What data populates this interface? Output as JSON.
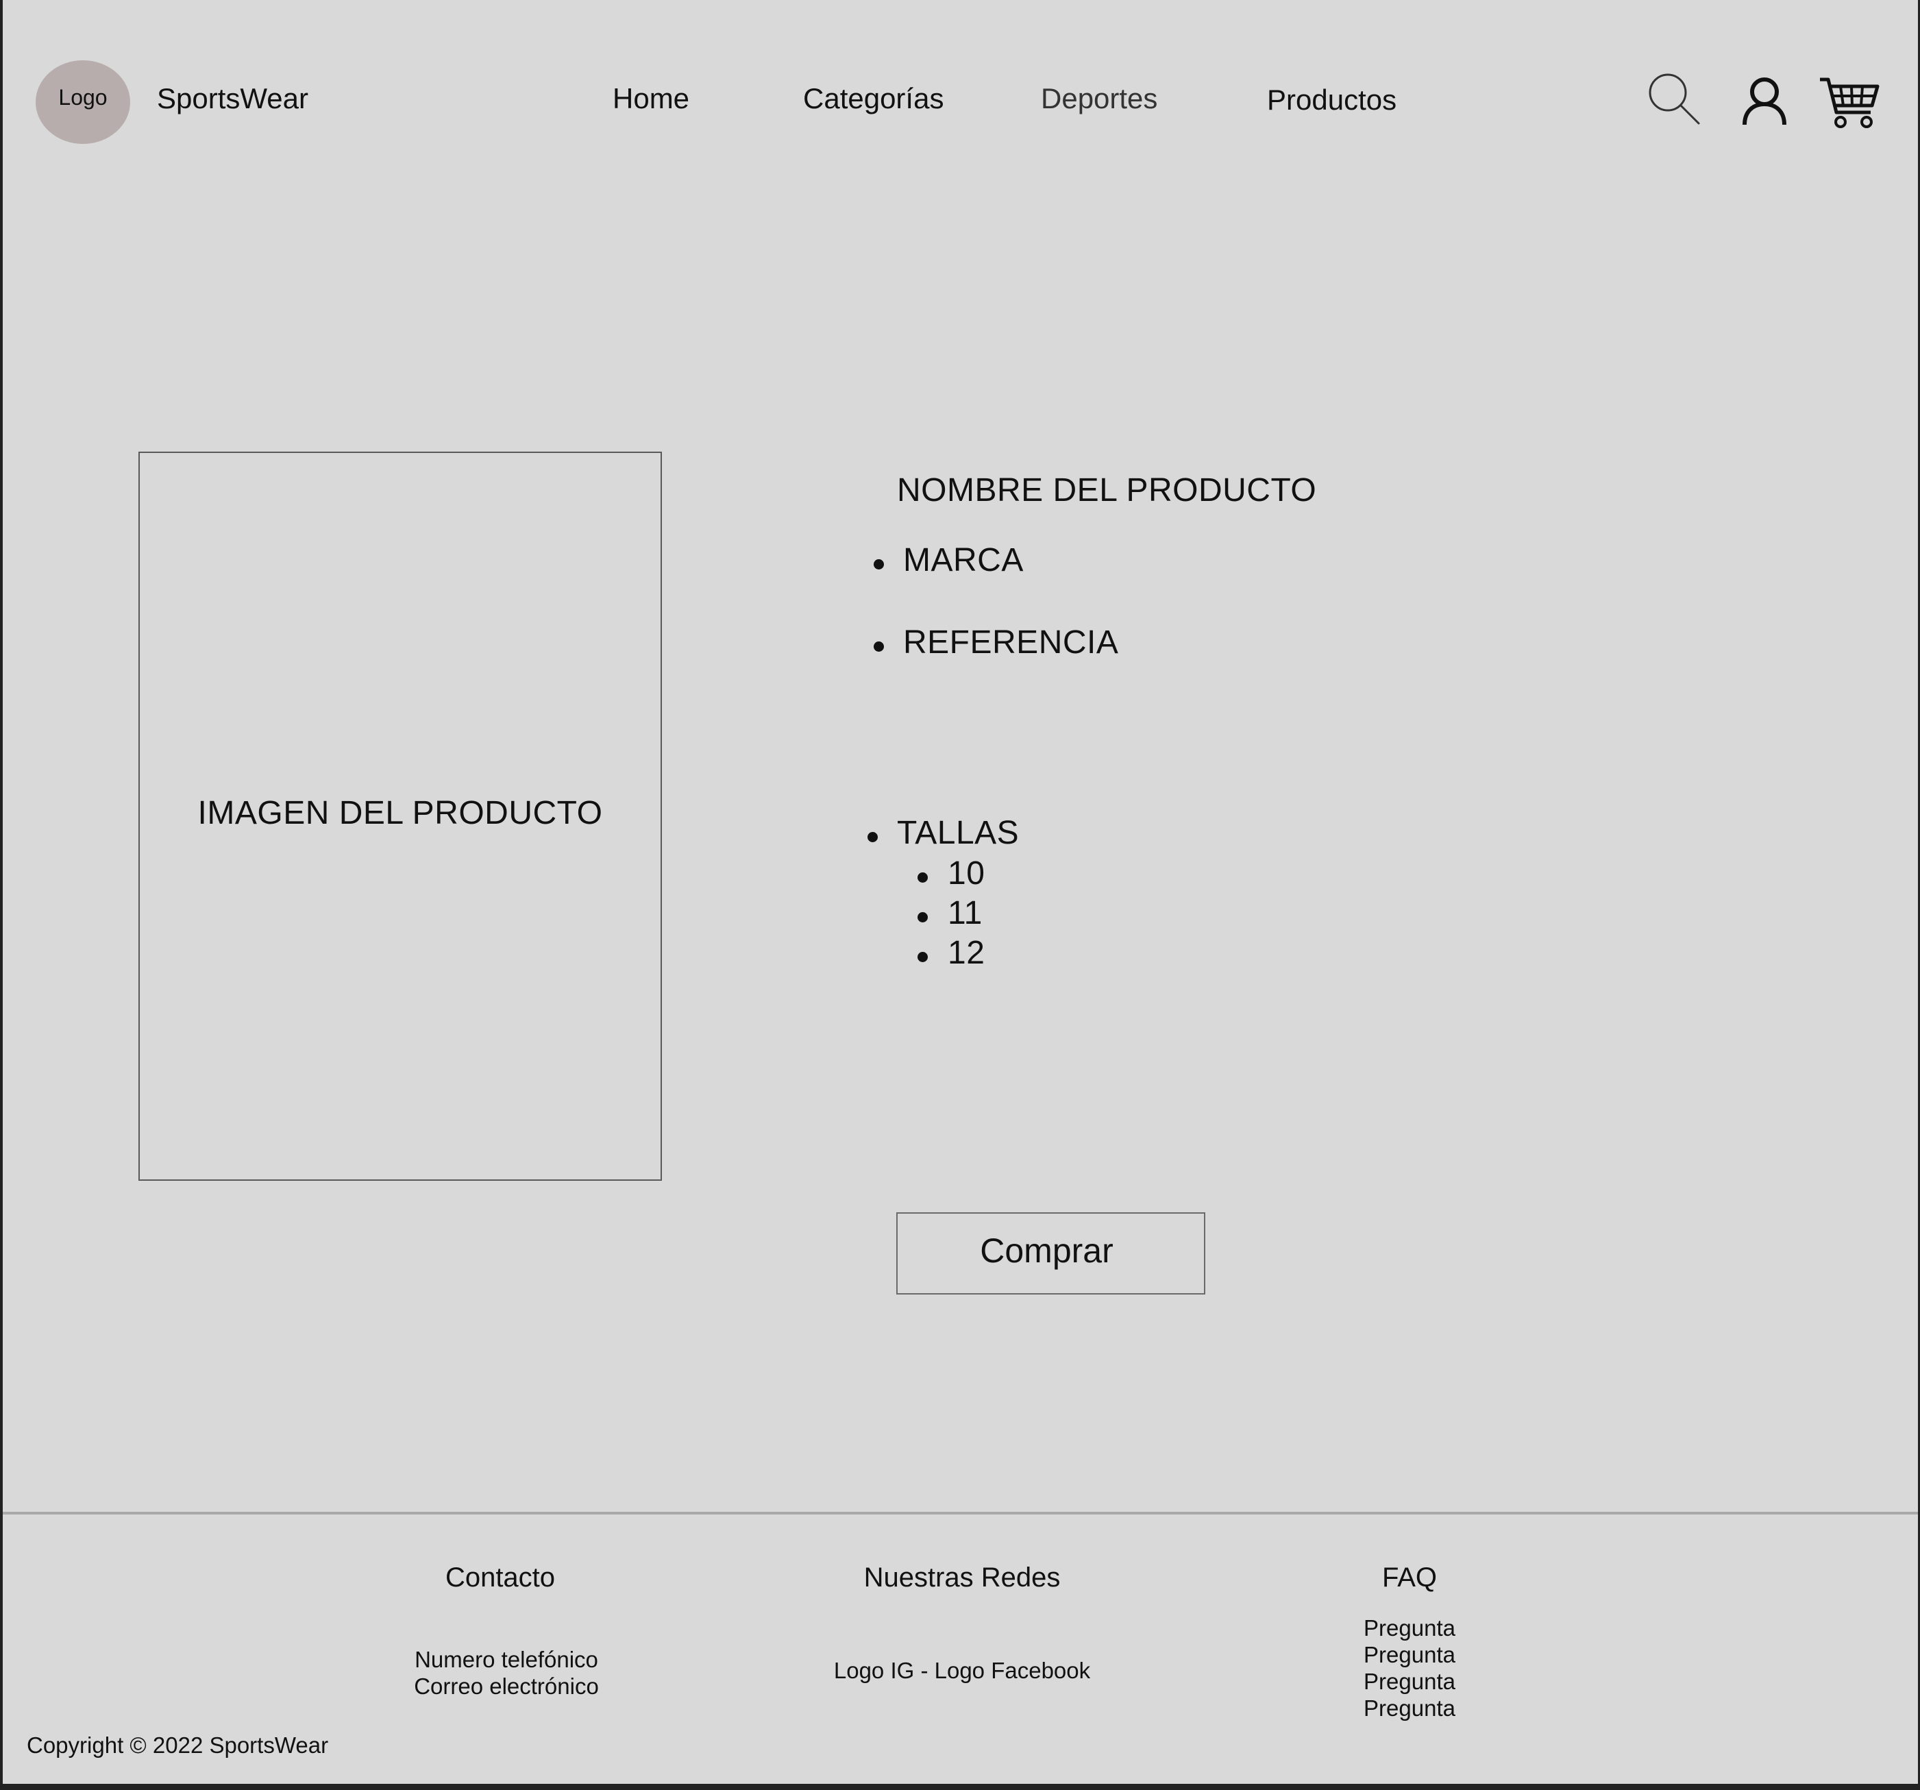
{
  "header": {
    "logo_label": "Logo",
    "brand_name": "SportsWear",
    "nav": [
      {
        "label": "Home"
      },
      {
        "label": "Categorías"
      },
      {
        "label": "Deportes"
      },
      {
        "label": "Productos"
      }
    ],
    "icons": [
      "search-icon",
      "user-icon",
      "cart-icon"
    ]
  },
  "product": {
    "image_placeholder": "IMAGEN DEL PRODUCTO",
    "name": "NOMBRE DEL PRODUCTO",
    "brand_label": "MARCA",
    "reference_label": "REFERENCIA",
    "sizes_label": "TALLAS",
    "sizes": [
      "10",
      "11",
      "12"
    ],
    "buy_label": "Comprar"
  },
  "footer": {
    "contact": {
      "heading": "Contacto",
      "lines": [
        "Numero telefónico",
        "Correo electrónico"
      ]
    },
    "social": {
      "heading": "Nuestras Redes",
      "text": "Logo IG - Logo Facebook"
    },
    "faq": {
      "heading": "FAQ",
      "items": [
        "Pregunta",
        "Pregunta",
        "Pregunta",
        "Pregunta"
      ]
    },
    "copyright": "Copyright © 2022 SportsWear"
  },
  "colors": {
    "page_background": "#d9d9d9",
    "frame": "#222222",
    "logo_circle": "#b8adad",
    "text": "#111111"
  }
}
